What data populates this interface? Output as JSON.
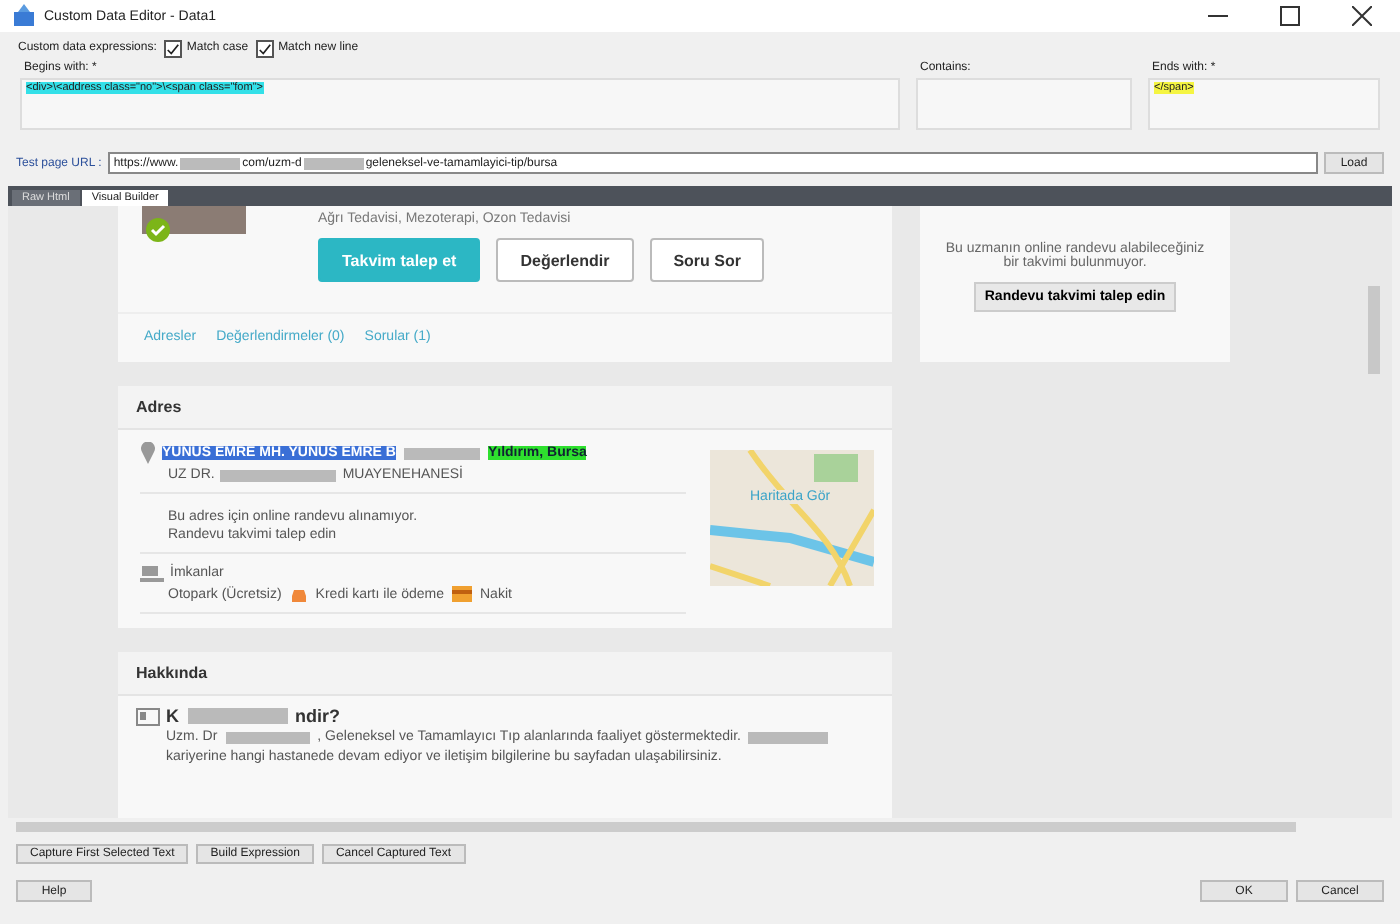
{
  "window": {
    "title": "Custom Data Editor - Data1"
  },
  "options": {
    "label": "Custom data expressions:",
    "checkboxes": [
      {
        "label": "Match case",
        "checked": true
      },
      {
        "label": "Match new line",
        "checked": true
      }
    ]
  },
  "expressions": [
    {
      "label": "Begins with: *",
      "value": "<div>\\<address class=\"no\">\\<span class=\"fom\">"
    },
    {
      "label": "Contains:"
    },
    {
      "label": "Ends with: *",
      "value": "</span>"
    }
  ],
  "url": {
    "label": "Test page URL :",
    "segments": [
      "https://www.",
      "com/uzm-d",
      "geleneksel-ve-tamamlayici-tip/bursa"
    ],
    "button": "Load"
  },
  "tabs": [
    {
      "label": "Raw Html",
      "selected": false
    },
    {
      "label": "Visual Builder",
      "selected": true
    }
  ],
  "profile": {
    "specialties": "Ağrı Tedavisi, Mezoterapi, Ozon Tedavisi",
    "buttons": [
      {
        "label": "Takvim talep et",
        "kind": "primary"
      },
      {
        "label": "Değerlendir",
        "kind": "outline"
      },
      {
        "label": "Soru Sor",
        "kind": "outline"
      }
    ],
    "links": [
      "Adresler",
      "Değerlendirmeler (0)",
      "Sorular (1)"
    ]
  },
  "calendar_card": {
    "message": "Bu uzmanın online randevu alabileceğiniz bir takvimi bulunmuyor.",
    "button": "Randevu takvimi talep edin"
  },
  "address": {
    "heading": "Adres",
    "street": "YUNUS EMRE MH. YUNUS EMRE B",
    "city": "Yıldırım, Bursa",
    "clinic_prefix": "UZ DR.",
    "clinic_suffix": "MUAYENEHANESİ",
    "note": "Bu adres için online randevu alınamıyor.",
    "link": "Randevu takvimi talep edin",
    "map_label": "Haritada Gör",
    "facilities_title": "İmkanlar",
    "facilities": [
      "Otopark (Ücretsiz)",
      "Kredi kartı ile ödeme",
      "Nakit"
    ]
  },
  "about": {
    "heading": "Hakkında",
    "question_start": "K",
    "question_end": "ndir?",
    "text_start": "Uzm. Dr",
    "text_middle": ", Geleneksel ve Tamamlayıcı Tıp alanlarında faaliyet göstermektedir.",
    "text_end": "kariyerine hangi hastanede devam ediyor ve iletişim bilgilerine bu sayfadan ulaşabilirsiniz."
  },
  "capture_buttons": [
    "Capture First Selected Text",
    "Build Expression",
    "Cancel Captured Text"
  ],
  "footer_buttons": {
    "help": "Help",
    "ok": "OK",
    "cancel": "Cancel"
  }
}
